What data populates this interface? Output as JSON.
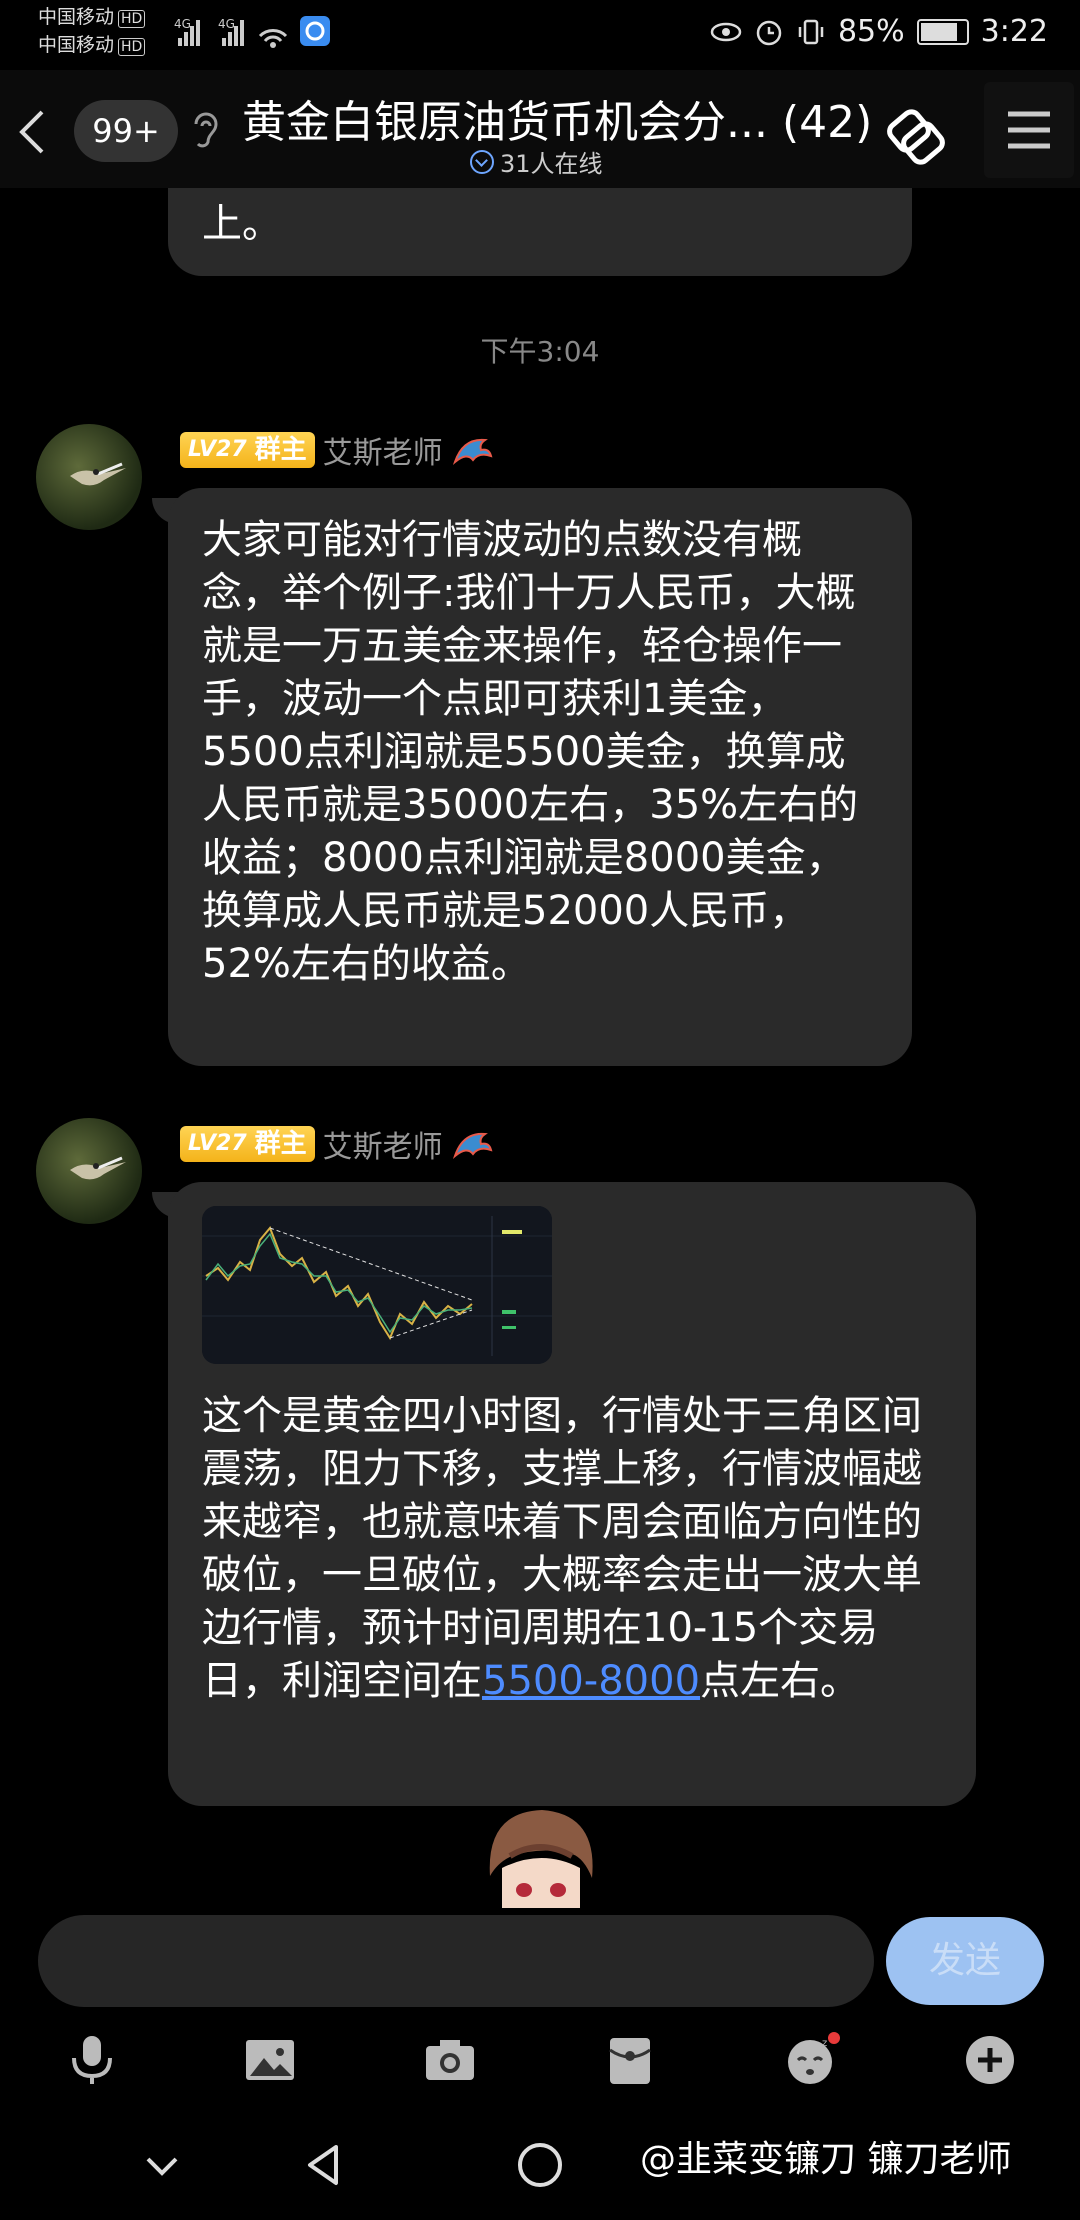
{
  "status_bar": {
    "carrier1": "中国移动",
    "carrier2": "中国移动",
    "hd": "HD",
    "signal": "4G",
    "battery": "85%",
    "time": "3:22"
  },
  "header": {
    "unread_count": "99+",
    "title": "黄金白银原油货币机会分...  (42)",
    "online": "31人在线"
  },
  "chat": {
    "prev_tail_text": "上。",
    "timestamp": "下午3:04",
    "messages": [
      {
        "level": "LV27",
        "role": "群主",
        "sender": "艾斯老师",
        "text": "大家可能对行情波动的点数没有概念，举个例子:我们十万人民币，大概就是一万五美金来操作，轻仓操作一手，波动一个点即可获利1美金，5500点利润就是5500美金，换算成人民币就是35000左右，35%左右的收益；8000点利润就是8000美金，换算成人民币就是52000人民币，52%左右的收益。"
      },
      {
        "level": "LV27",
        "role": "群主",
        "sender": "艾斯老师",
        "text": "这个是黄金四小时图，行情处于三角区间震荡，阻力下移，支撑上移，行情波幅越来越窄，也就意味着下周会面临方向性的破位，一旦破位，大概率会走出一波大单边行情，预计时间周期在10-15个交易日，利润空间在",
        "link": "5500-8000",
        "text_after": "点左右。"
      }
    ]
  },
  "input": {
    "placeholder": "",
    "send_label": "发送"
  },
  "watermark": "@韭菜变镰刀 镰刀老师",
  "colors": {
    "bubble": "#2a2a2a",
    "link": "#4e8cff",
    "send_button": "#9dc2f2",
    "badge": "#f4b31a"
  },
  "icons": [
    "back-chevron-icon",
    "ear-icon",
    "share-icon",
    "menu-icon",
    "mic-icon",
    "image-icon",
    "camera-icon",
    "red-packet-icon",
    "emoji-icon",
    "plus-icon",
    "nav-back-icon",
    "nav-home-icon",
    "nav-recents-icon"
  ]
}
